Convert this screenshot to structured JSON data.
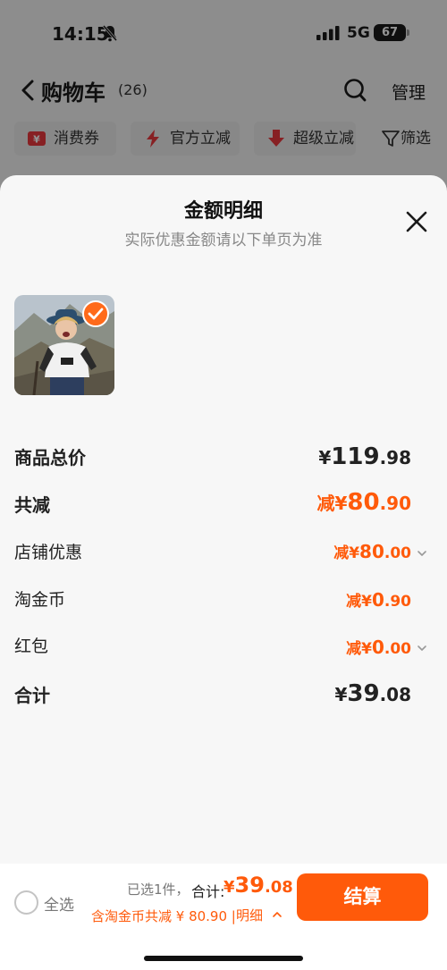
{
  "status_bar": {
    "time": "14:15",
    "network": "5G",
    "battery": "67"
  },
  "header": {
    "title": "购物车",
    "count": "(26)",
    "manage_label": "管理"
  },
  "filters": [
    {
      "label": "消费券",
      "icon": "coupon-icon",
      "color": "#e8383d"
    },
    {
      "label": "官方立减",
      "icon": "lightning-icon",
      "color": "#e8383d"
    },
    {
      "label": "超级立减",
      "icon": "down-arrow-icon",
      "color": "#e8383d"
    },
    {
      "label": "筛选",
      "icon": "filter-icon",
      "color": "#333333"
    }
  ],
  "sheet": {
    "title": "金额明细",
    "subtitle": "实际优惠金额请以下单页为准",
    "rows": {
      "subtotal": {
        "label": "商品总价",
        "yen": "¥",
        "int": "119",
        "dec": ".98"
      },
      "total_discount": {
        "label": "共减",
        "prefix": "减",
        "yen": "¥",
        "int": "80",
        "dec": ".90"
      },
      "store_discount": {
        "label": "店铺优惠",
        "prefix": "减",
        "yen": "¥",
        "int": "80",
        "dec": ".00"
      },
      "taojinbi": {
        "label": "淘金币",
        "prefix": "减",
        "yen": "¥",
        "int": "0",
        "dec": ".90"
      },
      "red_packet": {
        "label": "红包",
        "prefix": "减",
        "yen": "¥",
        "int": "0",
        "dec": ".00"
      },
      "grand_total": {
        "label": "合计",
        "yen": "¥",
        "int": "39",
        "dec": ".08"
      }
    }
  },
  "footer": {
    "select_all_label": "全选",
    "selected_info": "已选1件，",
    "total_label": "合计:",
    "total": {
      "yen": "¥",
      "int": "39",
      "dec": ".08"
    },
    "discount_note": "含淘金币共减 ¥ 80.90 | ",
    "detail_label": "明细",
    "checkout_label": "结算"
  },
  "colors": {
    "accent": "#ff5a0a",
    "muted": "#888888"
  }
}
